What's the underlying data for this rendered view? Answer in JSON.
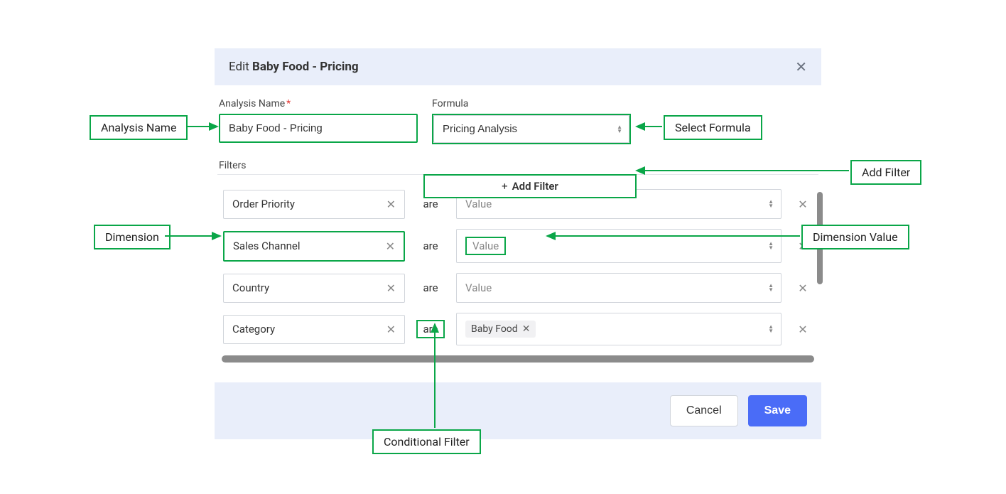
{
  "dialog": {
    "title_prefix": "Edit ",
    "title_bold": "Baby Food - Pricing"
  },
  "fields": {
    "analysis_name_label": "Analysis Name",
    "analysis_name_value": "Baby Food - Pricing",
    "formula_label": "Formula",
    "formula_value": "Pricing Analysis",
    "filters_label": "Filters",
    "add_filter_label": "Add Filter",
    "operator": "are",
    "value_placeholder": "Value"
  },
  "filters": [
    {
      "dimension": "Order Priority",
      "op": "are",
      "values": []
    },
    {
      "dimension": "Sales Channel",
      "op": "are",
      "values": []
    },
    {
      "dimension": "Country",
      "op": "are",
      "values": []
    },
    {
      "dimension": "Category",
      "op": "are",
      "values": [
        "Baby Food"
      ]
    }
  ],
  "footer": {
    "cancel": "Cancel",
    "save": "Save"
  },
  "annotations": {
    "analysis_name": "Analysis Name",
    "select_formula": "Select Formula",
    "add_filter": "Add Filter",
    "dimension": "Dimension",
    "dimension_value": "Dimension Value",
    "conditional_filter": "Conditional Filter"
  }
}
